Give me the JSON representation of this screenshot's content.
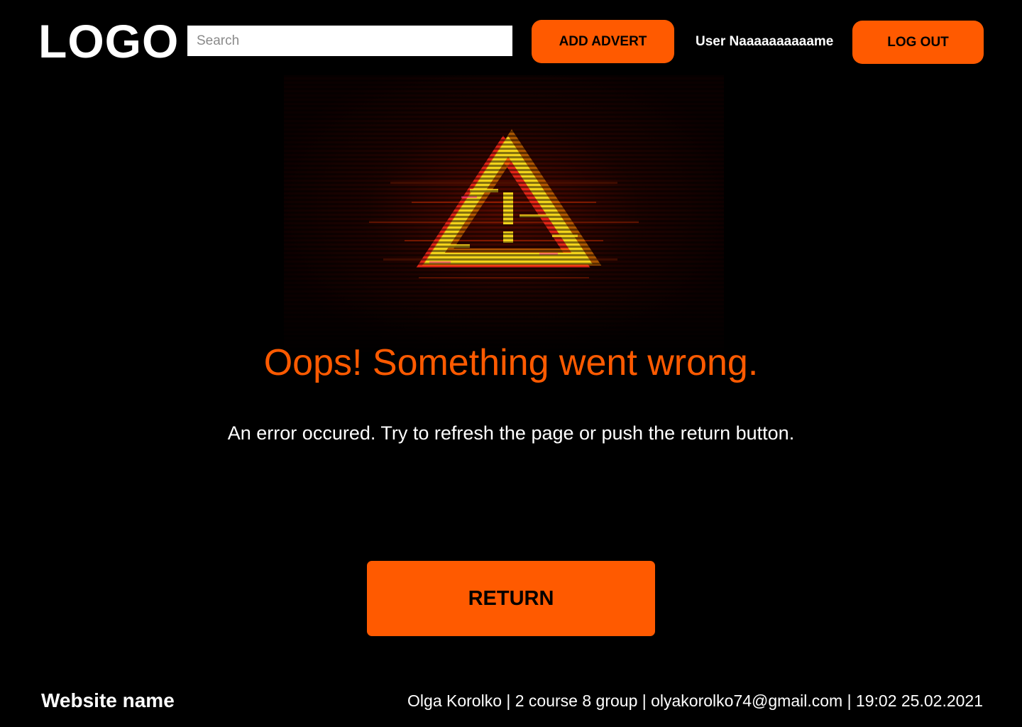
{
  "header": {
    "logo": "LOGO",
    "search_placeholder": "Search",
    "add_advert_label": "ADD ADVERT",
    "username": "User Naaaaaaaaaame",
    "logout_label": "LOG OUT"
  },
  "main": {
    "illustration_icon": "glitch-warning-triangle-icon",
    "title": "Oops! Something went wrong.",
    "message": "An error occured. Try to refresh the page or push the return button.",
    "return_label": "RETURN"
  },
  "footer": {
    "site_name": "Website name",
    "info": "Olga Korolko | 2 course 8 group | olyakorolko74@gmail.com | 19:02 25.02.2021"
  },
  "colors": {
    "background": "#000000",
    "accent": "#ff5a00",
    "text": "#ffffff",
    "warning_yellow": "#f2d21a"
  }
}
